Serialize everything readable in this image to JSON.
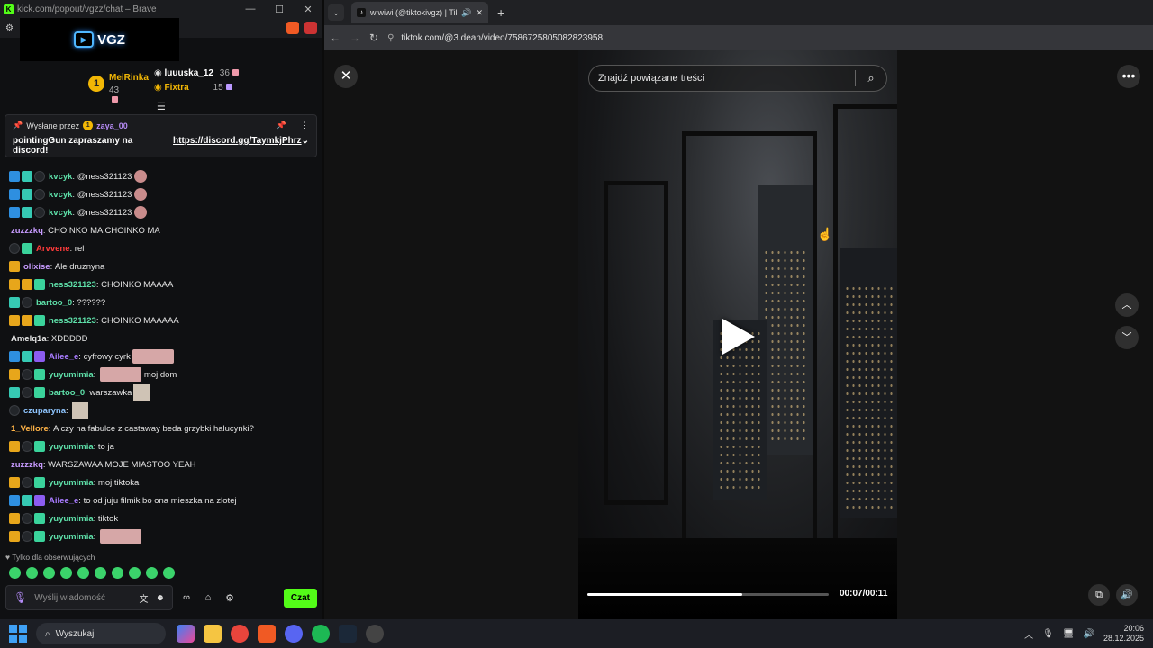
{
  "left_window": {
    "title": "kick.com/popout/vgzz/chat – Brave",
    "banner_text": "VGZ"
  },
  "leaderboard": {
    "first": {
      "rank": "1",
      "name": "MeiRinka",
      "count": "43"
    },
    "second": {
      "name": "luuuska_12",
      "count": "36"
    },
    "third": {
      "name": "Fixtra",
      "count": "15"
    }
  },
  "pinned": {
    "sent_by_label": "Wysłane przez",
    "badge": "1",
    "author": "zaya_00",
    "text": "pointingGun zapraszamy na discord!",
    "link": "https://discord.gg/TaymkjPhrz"
  },
  "chat": [
    {
      "badges": [
        "blue",
        "teal",
        "dark"
      ],
      "user": "kvcyk",
      "color": "#5ee0a9",
      "text": "@ness321123",
      "emote": "round"
    },
    {
      "badges": [
        "blue",
        "teal",
        "dark"
      ],
      "user": "kvcyk",
      "color": "#5ee0a9",
      "text": "@ness321123",
      "emote": "round"
    },
    {
      "badges": [
        "blue",
        "teal",
        "dark"
      ],
      "user": "kvcyk",
      "color": "#5ee0a9",
      "text": "@ness321123",
      "emote": "round"
    },
    {
      "badges": [],
      "user": "zuzzzkq",
      "color": "#c79bff",
      "text": "CHOINKO MA CHOINKO MA",
      "emote": ""
    },
    {
      "badges": [
        "dark",
        "green"
      ],
      "user": "Arvvene",
      "color": "#ff3b3b",
      "text": "rel",
      "emote": ""
    },
    {
      "badges": [
        "gold"
      ],
      "user": "olixise",
      "color": "#c79bff",
      "text": "Ale druznyna",
      "emote": ""
    },
    {
      "badges": [
        "gold",
        "gold",
        "green"
      ],
      "user": "ness321123",
      "color": "#5ee0a9",
      "text": "CHOINKO MAAAA",
      "emote": ""
    },
    {
      "badges": [
        "teal",
        "dark"
      ],
      "user": "bartoo_0",
      "color": "#5ee0a9",
      "text": "??????",
      "emote": ""
    },
    {
      "badges": [
        "gold",
        "gold",
        "green"
      ],
      "user": "ness321123",
      "color": "#5ee0a9",
      "text": "CHOINKO MAAAAA",
      "emote": ""
    },
    {
      "badges": [],
      "user": "Amelq1a",
      "color": "#e4e4e4",
      "text": "XDDDDD",
      "emote": ""
    },
    {
      "badges": [
        "blue",
        "teal",
        "purple"
      ],
      "user": "Ailee_e",
      "color": "#a87bff",
      "text": "cyfrowy cyrk",
      "emote": "wide"
    },
    {
      "badges": [
        "gold",
        "dark",
        "green"
      ],
      "user": "yuyumimia",
      "color": "#5ee0a9",
      "text": "",
      "emote": "wide",
      "after": "moj dom"
    },
    {
      "badges": [
        "teal",
        "dark",
        "green"
      ],
      "user": "bartoo_0",
      "color": "#5ee0a9",
      "text": "warszawka",
      "emote": "sq"
    },
    {
      "badges": [
        "dark"
      ],
      "user": "czuparyna",
      "color": "#8ec5ff",
      "text": "",
      "emote": "sq"
    },
    {
      "badges": [],
      "user": "1_Vellore",
      "color": "#ffb347",
      "text": "A czy na fabulce z castaway beda grzybki halucynki?",
      "emote": ""
    },
    {
      "badges": [
        "gold",
        "dark",
        "green"
      ],
      "user": "yuyumimia",
      "color": "#5ee0a9",
      "text": "to ja",
      "emote": ""
    },
    {
      "badges": [],
      "user": "zuzzzkq",
      "color": "#c79bff",
      "text": "WARSZAWAA MOJE MIASTOO YEAH",
      "emote": ""
    },
    {
      "badges": [
        "gold",
        "dark",
        "green"
      ],
      "user": "yuyumimia",
      "color": "#5ee0a9",
      "text": "moj tiktoka",
      "emote": ""
    },
    {
      "badges": [
        "blue",
        "teal",
        "purple"
      ],
      "user": "Ailee_e",
      "color": "#a87bff",
      "text": "to od juju filmik bo ona mieszka na zlotej",
      "emote": ""
    },
    {
      "badges": [
        "gold",
        "dark",
        "green"
      ],
      "user": "yuyumimia",
      "color": "#5ee0a9",
      "text": "tiktok",
      "emote": ""
    },
    {
      "badges": [
        "gold",
        "dark",
        "green"
      ],
      "user": "yuyumimia",
      "color": "#5ee0a9",
      "text": "",
      "emote": "wide"
    }
  ],
  "chat_footer": {
    "followers_only": "Tylko dla obserwujących",
    "input_placeholder": "Wyślij wiadomość",
    "send_label": "Czat"
  },
  "browser": {
    "tab_title": "wiwiwi (@tiktokivgz) | TikTok",
    "url": "tiktok.com/@3.dean/video/7586725805082823958"
  },
  "tiktok": {
    "search_placeholder": "Znajdź powiązane treści",
    "time": "00:07/00:11",
    "progress": 0.64
  },
  "taskbar": {
    "search_label": "Wyszukaj",
    "time": "20:06",
    "date": "28.12.2025"
  }
}
